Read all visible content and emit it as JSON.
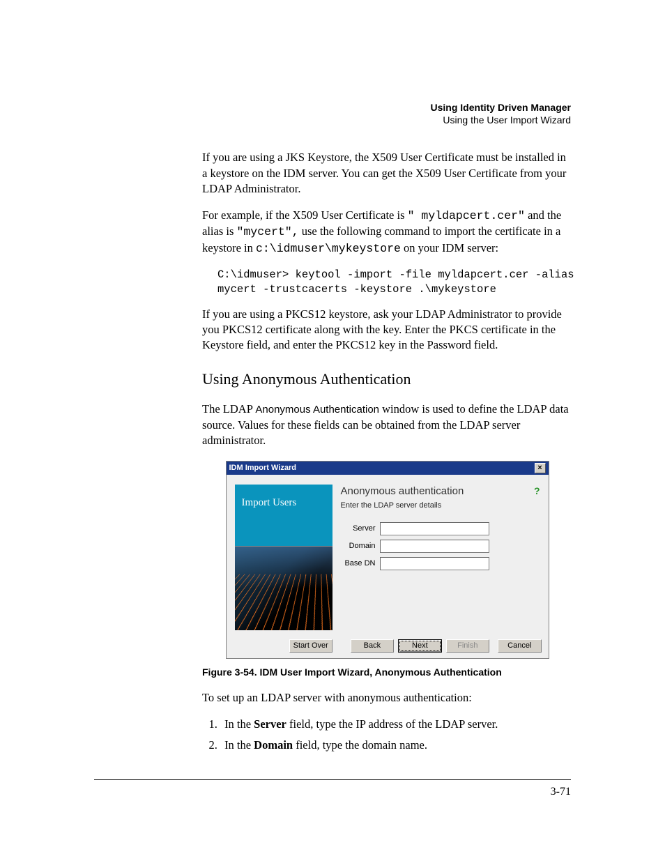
{
  "header": {
    "title": "Using Identity Driven Manager",
    "subtitle": "Using the User Import Wizard"
  },
  "para1_a": "If you are using a JKS Keystore, the X509 User Certificate must be installed in a keystore on the IDM server. You can get the X509 User Certificate from your LDAP Administrator.",
  "para2_a": "For example, if the X509 User Certificate is",
  "para2_code1": "\" myldapcert.cer\"",
  "para2_b": " and the alias is ",
  "para2_code2": "\"mycert\",",
  "para2_c": "  use the following command to import the certificate in a keystore in ",
  "para2_code3": "c:\\idmuser\\mykeystore",
  "para2_d": " on your IDM server:",
  "codeblock": "C:\\idmuser> keytool -import -file myldapcert.cer -alias\nmycert -trustcacerts -keystore .\\mykeystore",
  "para3": "If you are using a PKCS12 keystore, ask your LDAP Administrator to provide you PKCS12 certificate along with the key. Enter the PKCS certificate in the Keystore field, and enter the PKCS12 key in the Password field.",
  "subheading": "Using Anonymous Authentication",
  "para4_a": "The LDAP ",
  "para4_sans": "Anonymous Authentication",
  "para4_b": " window is used to define the LDAP data source. Values for these fields can be obtained from the LDAP server administrator.",
  "wizard": {
    "window_title": "IDM Import Wizard",
    "close": "×",
    "left_title": "Import Users",
    "panel_title": "Anonymous authentication",
    "panel_sub": "Enter the LDAP server details",
    "labels": {
      "server": "Server",
      "domain": "Domain",
      "basedn": "Base DN"
    },
    "help": "?",
    "buttons": {
      "startover": "Start Over",
      "back": "Back",
      "next": "Next",
      "finish": "Finish",
      "cancel": "Cancel"
    }
  },
  "caption": "Figure 3-54. IDM User Import Wizard, Anonymous Authentication",
  "setup_intro": "To set up an LDAP server with anonymous authentication:",
  "steps": {
    "s1_a": "In the ",
    "s1_b": "Server",
    "s1_c": " field, type the IP address of the LDAP server.",
    "s2_a": "In the ",
    "s2_b": "Domain",
    "s2_c": " field, type the domain name."
  },
  "pagenum": "3-71"
}
